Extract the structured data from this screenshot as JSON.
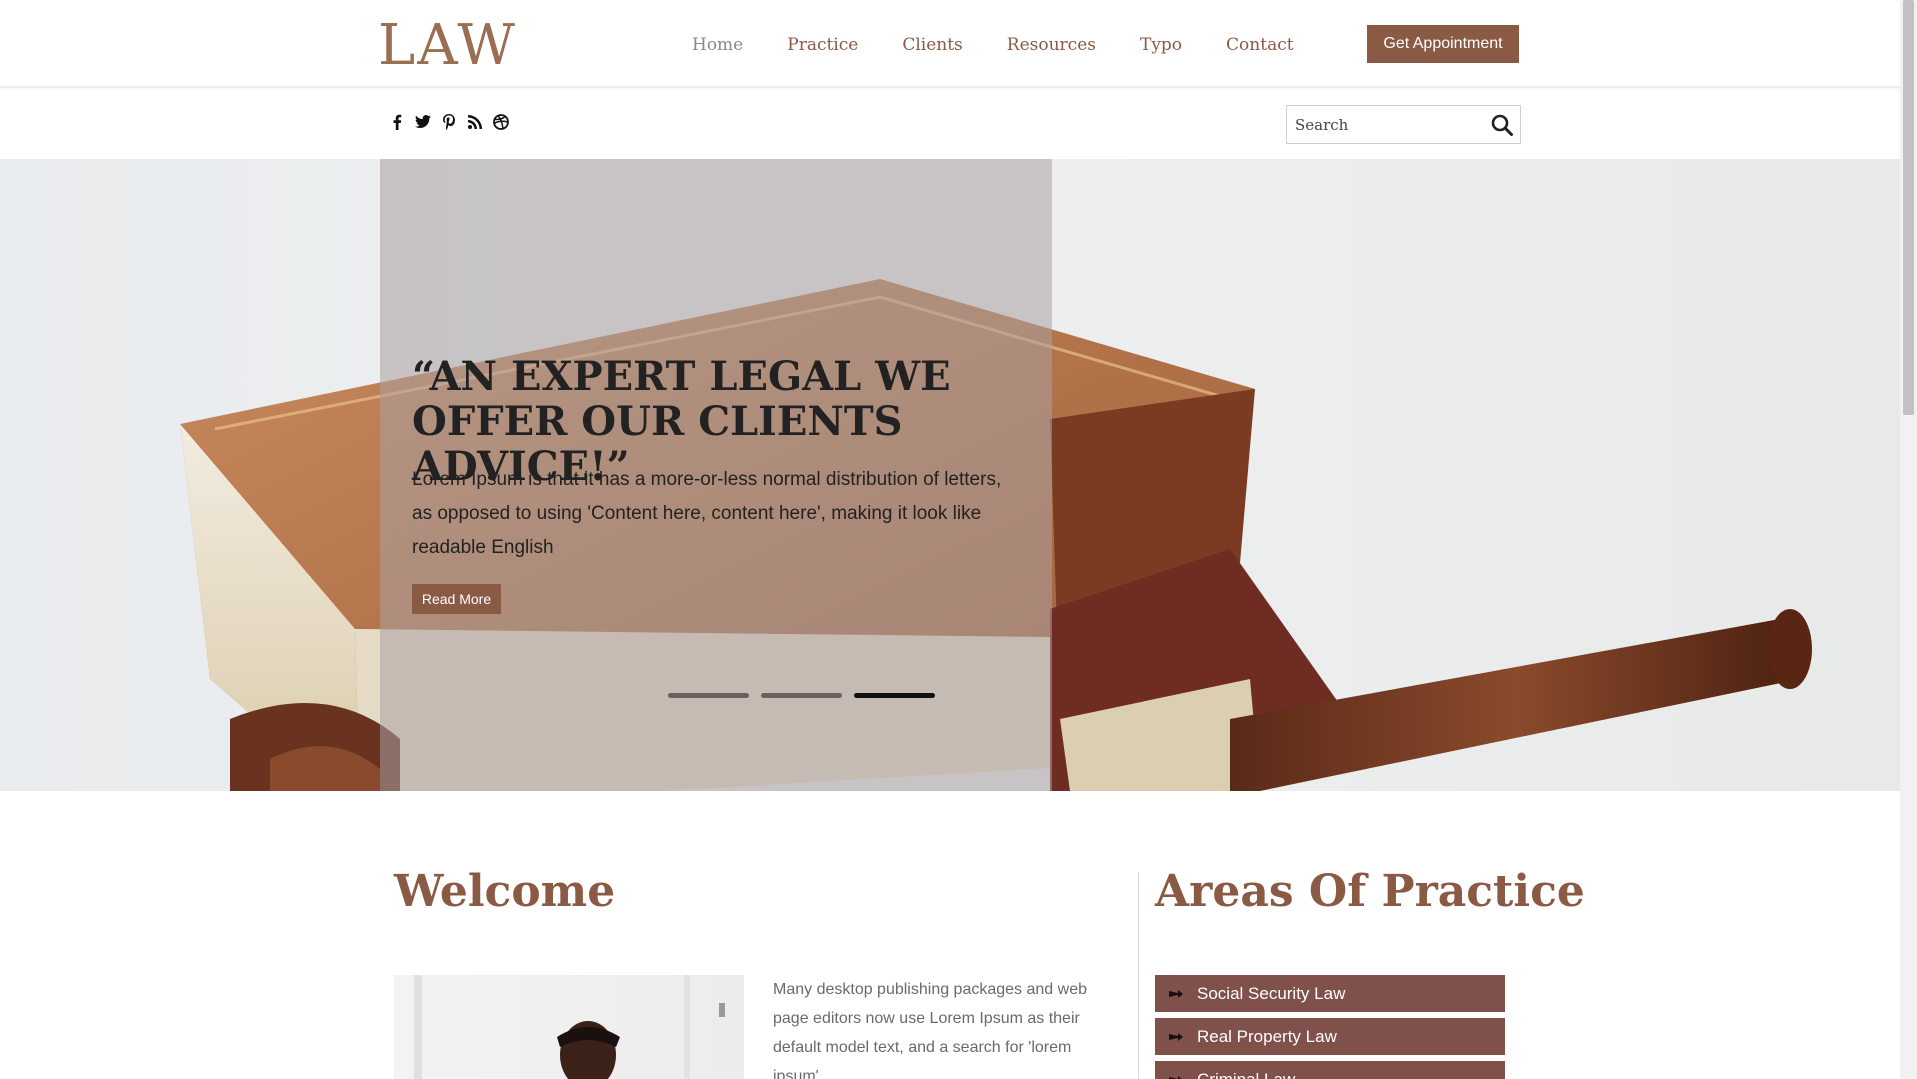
{
  "header": {
    "logo": "LAW",
    "nav": [
      {
        "label": "Home"
      },
      {
        "label": "Practice"
      },
      {
        "label": "Clients"
      },
      {
        "label": "Resources"
      },
      {
        "label": "Typo"
      },
      {
        "label": "Contact"
      }
    ],
    "cta_label": "Get Appointment",
    "social_icons": [
      "facebook-icon",
      "twitter-icon",
      "pinterest-icon",
      "rss-icon",
      "dribbble-icon"
    ],
    "search": {
      "placeholder": "Search"
    }
  },
  "hero": {
    "title": "“AN EXPERT LEGAL WE OFFER OUR CLIENTS ADVICE!”",
    "text": "Lorem Ipsum is that it has a more-or-less normal distribution of letters, as opposed to using 'Content here, content here', making it look like readable English",
    "button": "Read More",
    "slides": 3,
    "active_slide": 3
  },
  "welcome": {
    "title": "Welcome",
    "text": "Many desktop publishing packages and web page editors now use Lorem Ipsum as their default model text, and a search for 'lorem ipsum'"
  },
  "areas": {
    "title": "Areas Of Practice",
    "items": [
      {
        "label": "Social Security Law"
      },
      {
        "label": "Real Property Law"
      },
      {
        "label": "Criminal Law"
      }
    ]
  },
  "colors": {
    "brand": "#8b5a45",
    "list_bg": "#80504a"
  }
}
